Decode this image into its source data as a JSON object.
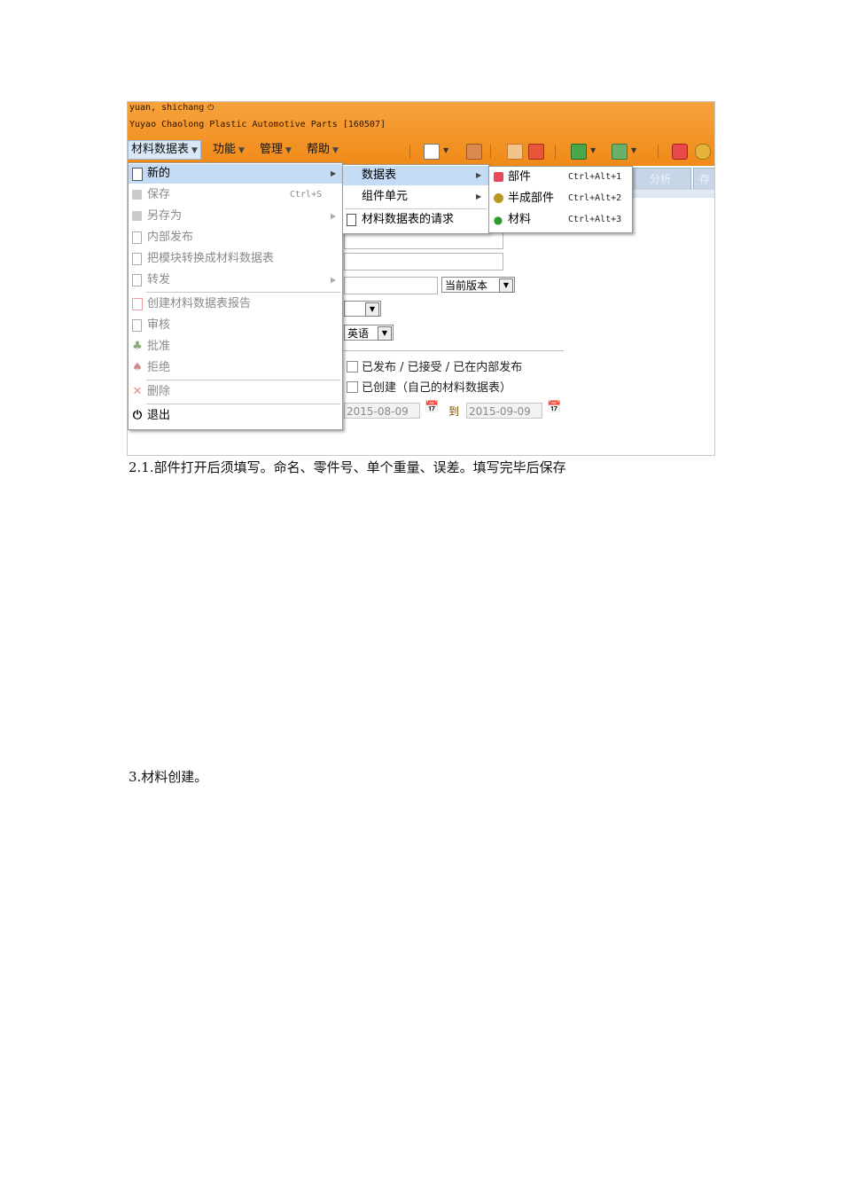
{
  "header": {
    "user": "yuan, shichang",
    "power_symbol": "⏻",
    "company": "Yuyao Chaolong Plastic Automotive Parts [160507]"
  },
  "menubar": [
    {
      "label": "材料数据表"
    },
    {
      "label": "功能"
    },
    {
      "label": "管理"
    },
    {
      "label": "帮助"
    }
  ],
  "tabs": {
    "analysis": "分析",
    "next": "存"
  },
  "main_menu": {
    "items": [
      {
        "label": "新的",
        "icon": "new-document-icon",
        "shortcut": "",
        "has_submenu": true,
        "enabled": true,
        "highlighted": true
      },
      {
        "label": "保存",
        "icon": "save-icon",
        "shortcut": "Ctrl+S",
        "has_submenu": false,
        "enabled": false
      },
      {
        "label": "另存为",
        "icon": "save-as-icon",
        "shortcut": "",
        "has_submenu": true,
        "enabled": false
      },
      {
        "label": "内部发布",
        "icon": "internal-publish-icon",
        "shortcut": "",
        "has_submenu": false,
        "enabled": false
      },
      {
        "label": "把模块转换成材料数据表",
        "icon": "convert-icon",
        "shortcut": "",
        "has_submenu": false,
        "enabled": false
      },
      {
        "label": "转发",
        "icon": "forward-icon",
        "shortcut": "",
        "has_submenu": true,
        "enabled": false
      },
      {
        "label": "创建材料数据表报告",
        "icon": "pdf-report-icon",
        "shortcut": "",
        "has_submenu": false,
        "enabled": false
      },
      {
        "label": "审核",
        "icon": "review-icon",
        "shortcut": "",
        "has_submenu": false,
        "enabled": false
      },
      {
        "label": "批准",
        "icon": "approve-icon",
        "shortcut": "",
        "has_submenu": false,
        "enabled": false
      },
      {
        "label": "拒绝",
        "icon": "reject-icon",
        "shortcut": "",
        "has_submenu": false,
        "enabled": false
      },
      {
        "label": "删除",
        "icon": "delete-icon",
        "shortcut": "",
        "has_submenu": false,
        "enabled": false
      },
      {
        "label": "退出",
        "icon": "power-icon",
        "shortcut": "",
        "has_submenu": false,
        "enabled": true
      }
    ]
  },
  "new_submenu": {
    "items": [
      {
        "label": "数据表",
        "has_submenu": true,
        "highlighted": true
      },
      {
        "label": "组件单元",
        "has_submenu": true
      },
      {
        "label": "材料数据表的请求",
        "has_submenu": false,
        "icon": "request-icon"
      }
    ]
  },
  "datasheet_submenu": {
    "items": [
      {
        "label": "部件",
        "shortcut": "Ctrl+Alt+1",
        "icon": "component-icon"
      },
      {
        "label": "半成部件",
        "shortcut": "Ctrl+Alt+2",
        "icon": "semi-component-icon"
      },
      {
        "label": "材料",
        "shortcut": "Ctrl+Alt+3",
        "icon": "material-icon"
      }
    ]
  },
  "form": {
    "version_select": "当前版本",
    "language_select": "英语",
    "checkbox_published": "已发布 / 已接受 / 已在内部发布",
    "checkbox_created": "已创建（自己的材料数据表）",
    "date_from": "2015-08-09",
    "date_to_label": "到",
    "date_to": "2015-09-09"
  },
  "document": {
    "caption_1": "2.1.部件打开后须填写。命名、零件号、单个重量、误差。填写完毕后保存",
    "caption_2": "3.材料创建。"
  },
  "colors": {
    "topbar": "#f08a18",
    "menu_highlight": "#c3dbf5",
    "disabled_text": "#8a8a8a"
  }
}
